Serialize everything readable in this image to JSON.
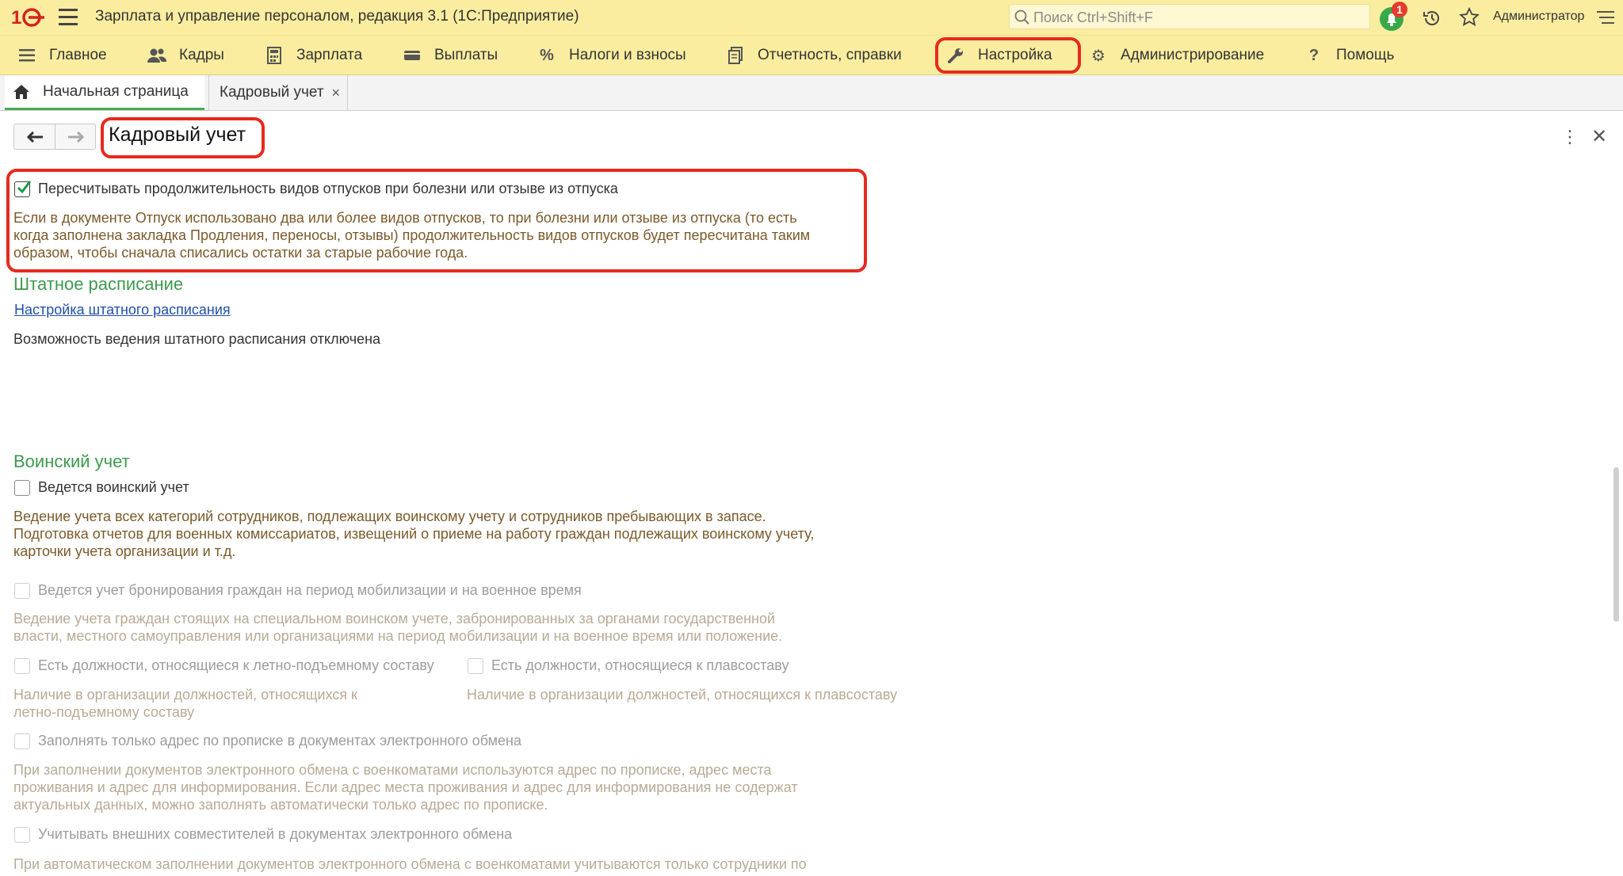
{
  "titlebar": {
    "app_title": "Зарплата и управление персоналом, редакция 3.1  (1С:Предприятие)",
    "search_placeholder": "Поиск Ctrl+Shift+F",
    "notification_count": "1",
    "user": "Администратор"
  },
  "menu": {
    "items": [
      {
        "label": "Главное",
        "icon": "menu-lines-icon"
      },
      {
        "label": "Кадры",
        "icon": "people-icon"
      },
      {
        "label": "Зарплата",
        "icon": "calculator-icon"
      },
      {
        "label": "Выплаты",
        "icon": "wallet-icon"
      },
      {
        "label": "Налоги и взносы",
        "icon": "percent-icon"
      },
      {
        "label": "Отчетность, справки",
        "icon": "documents-icon"
      },
      {
        "label": "Настройка",
        "icon": "wrench-icon"
      },
      {
        "label": "Администрирование",
        "icon": "gear-icon"
      },
      {
        "label": "Помощь",
        "icon": "question-icon"
      }
    ],
    "highlighted": "Настройка"
  },
  "tabs": {
    "home": "Начальная страница",
    "current": "Кадровый учет"
  },
  "form": {
    "title": "Кадровый учет",
    "recalc_checkbox": {
      "label": "Пересчитывать продолжительность видов отпусков при болезни или отзыве из отпуска",
      "checked": true,
      "description_lines": [
        "Если в документе Отпуск использовано два или более видов отпусков, то при болезни или отзыве из отпуска (то есть",
        "когда заполнена закладка Продления, переносы, отзывы) продолжительность видов отпусков будет пересчитана таким",
        "образом, чтобы сначала списались остатки за старые рабочие года."
      ]
    },
    "staffing": {
      "heading": "Штатное расписание",
      "link": "Настройка штатного расписания",
      "status": "Возможность ведения штатного расписания отключена"
    },
    "military": {
      "heading": "Воинский учет",
      "main_checkbox": "Ведется воинский учет",
      "main_description": [
        "Ведение учета всех категорий сотрудников, подлежащих воинскому учету и сотрудников пребывающих в запасе.",
        "Подготовка отчетов для военных комиссариатов, извещений о приеме на работу граждан подлежащих воинскому учету,",
        "карточки учета организации и т.д."
      ],
      "reservation_checkbox": "Ведется учет бронирования граждан на период мобилизации и на военное время",
      "reservation_description": [
        "Ведение учета граждан стоящих на специальном воинском учете, забронированных за органами государственной",
        "власти, местного самоуправления или организациями на период мобилизации и на военное время или положение."
      ],
      "flight_checkbox": "Есть должности, относящиеся к летно-подъемному составу",
      "flight_description": [
        "Наличие в организации должностей, относящихся к",
        "летно-подъемному составу"
      ],
      "sea_checkbox": "Есть должности, относящиеся к плавсоставу",
      "sea_description": "Наличие в организации должностей, относящихся к плавсоставу",
      "address_checkbox": "Заполнять только адрес по прописке в документах электронного обмена",
      "address_description": [
        "При заполнении документов электронного обмена с военкоматами используются адрес по прописке, адрес места",
        "проживания и адрес для информирования. Если адрес места проживания и адрес для информирования не содержат",
        "актуальных данных, можно заполнять автоматически только адрес по прописке."
      ],
      "external_checkbox": "Учитывать внешних совместителей в документах электронного обмена",
      "external_description": "При автоматическом заполнении документов электронного обмена с военкоматами учитываются только сотрудники по"
    }
  },
  "colors": {
    "toolbar_bg": "#fbeda0",
    "highlight_red": "#e62a1e",
    "section_green": "#3e9a4e",
    "description_brown": "#7a5a2a",
    "link_blue": "#1f4fa8"
  }
}
